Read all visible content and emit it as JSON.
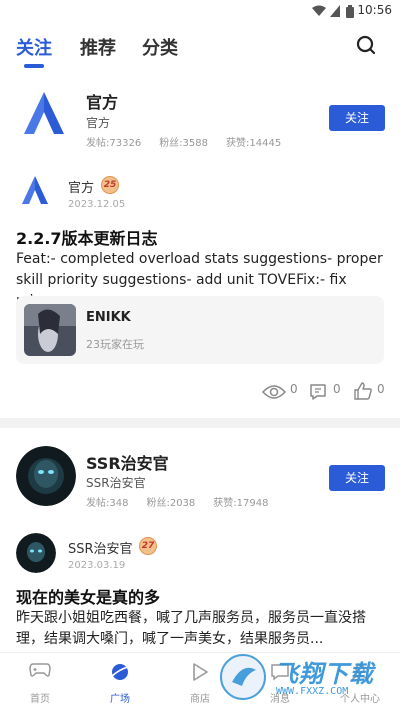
{
  "status_bar": {
    "time": "10:56"
  },
  "tabs": [
    {
      "label": "关注",
      "active": true
    },
    {
      "label": "推荐",
      "active": false
    },
    {
      "label": "分类",
      "active": false
    }
  ],
  "card1": {
    "name": "官方",
    "subtitle": "官方",
    "stats": {
      "posts": "发帖:73326",
      "fans": "粉丝:3588",
      "likes": "获赞:14445"
    },
    "follow_label": "关注",
    "post": {
      "author": "官方",
      "level": "25",
      "date": "2023.12.05",
      "title": "2.2.7版本更新日志",
      "body": "Feat:- completed overload stats suggestions- proper skill priority suggestions- add unit TOVEFix:- fix min...",
      "game": {
        "name": "ENIKK",
        "players": "23玩家在玩"
      },
      "views": "0",
      "comments": "0",
      "likes": "0"
    }
  },
  "card2": {
    "name": "SSR治安官",
    "subtitle": "SSR治安官",
    "stats": {
      "posts": "发帖:348",
      "fans": "粉丝:2038",
      "likes": "获赞:17948"
    },
    "follow_label": "关注",
    "post": {
      "author": "SSR治安官",
      "level": "27",
      "date": "2023.03.19",
      "title": "现在的美女是真的多",
      "body": "昨天跟小姐姐吃西餐，喊了几声服务员，服务员一直没搭理，结果调大嗓门，喊了一声美女，结果服务员..."
    }
  },
  "bottom_nav": [
    {
      "label": "首页",
      "icon": "gamepad-icon",
      "active": false
    },
    {
      "label": "广场",
      "icon": "planet-icon",
      "active": true
    },
    {
      "label": "商店",
      "icon": "play-icon",
      "active": false
    },
    {
      "label": "消息",
      "icon": "message-icon",
      "active": false
    },
    {
      "label": "个人中心",
      "icon": "user-icon",
      "active": false
    }
  ],
  "watermark": {
    "text": "飞翔下载",
    "url": "WWW.FXXZ.COM"
  },
  "colors": {
    "accent": "#2b5bd6"
  }
}
